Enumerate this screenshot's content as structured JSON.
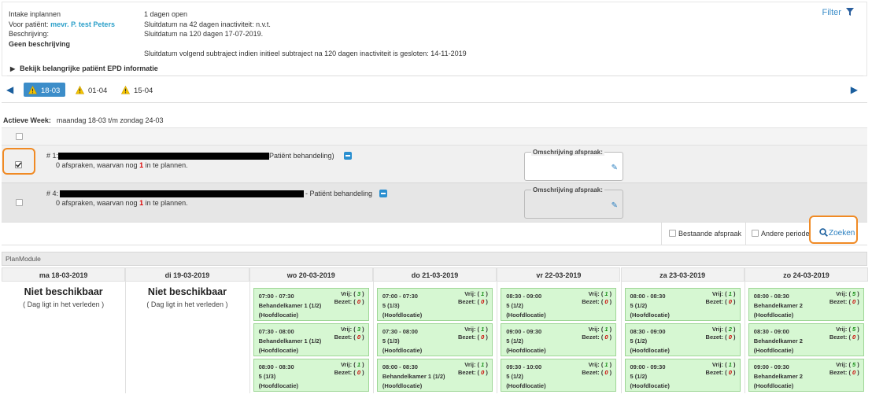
{
  "header": {
    "intake": "Intake inplannen",
    "patient_label": "Voor patiënt:",
    "patient_name": "mevr. P. test Peters",
    "beschrijving_label": "Beschrijving:",
    "beschrijving_value": "Geen beschrijving",
    "dagen_open": "1 dagen open",
    "sluit42": "Sluitdatum na 42 dagen inactiviteit: n.v.t.",
    "sluit120": "Sluitdatum na 120 dagen 17-07-2019.",
    "sluit_volgend": "Sluitdatum volgend subtraject indien initieel subtraject na 120 dagen inactiviteit is gesloten: 14-11-2019",
    "filter_label": "Filter",
    "epd_link": "Bekijk belangrijke patiënt EPD informatie"
  },
  "weeknav": {
    "tabs": [
      "18-03",
      "01-04",
      "15-04"
    ],
    "active_index": 0,
    "active_week_label": "Actieve Week:",
    "active_week_value": "maandag 18-03 t/m zondag 24-03"
  },
  "rows": [
    {
      "prefix": "# 1:",
      "suffix": "Patiënt behandeling)",
      "line2_a": "0 afspraken, waarvan nog ",
      "count": "1",
      "line2_b": " in te plannen.",
      "checked": true,
      "omschrijving_label": "Omschrijving afspraak:"
    },
    {
      "prefix": "# 4:",
      "suffix": "- Patiënt behandeling",
      "line2_a": "0 afspraken, waarvan nog ",
      "count": "1",
      "line2_b": " in te plannen.",
      "checked": false,
      "omschrijving_label": "Omschrijving afspraak:"
    }
  ],
  "searchbar": {
    "bestaande": "Bestaande afspraak",
    "andere": "Andere periode",
    "zoeken": "Zoeken"
  },
  "planmodule": {
    "title": "PlanModule",
    "niet_beschikbaar": "Niet beschikbaar",
    "verleden": "( Dag ligt in het verleden )",
    "vrij_label": "Vrij:",
    "bezet_label": "Bezet:",
    "days": [
      {
        "label": "ma 18-03-2019",
        "slots": []
      },
      {
        "label": "di 19-03-2019",
        "slots": []
      },
      {
        "label": "wo 20-03-2019",
        "slots": [
          {
            "time": "07:00 - 07:30",
            "room": "Behandelkamer 1 (1/2)",
            "loc": "(Hoofdlocatie)",
            "vrij": "3",
            "bezet": "0"
          },
          {
            "time": "07:30 - 08:00",
            "room": "Behandelkamer 1 (1/2)",
            "loc": "(Hoofdlocatie)",
            "vrij": "3",
            "bezet": "0"
          },
          {
            "time": "08:00 - 08:30",
            "room": "5 (1/3)",
            "loc": "(Hoofdlocatie)",
            "vrij": "1",
            "bezet": "0"
          }
        ]
      },
      {
        "label": "do 21-03-2019",
        "slots": [
          {
            "time": "07:00 - 07:30",
            "room": "5 (1/3)",
            "loc": "(Hoofdlocatie)",
            "vrij": "1",
            "bezet": "0"
          },
          {
            "time": "07:30 - 08:00",
            "room": "5 (1/3)",
            "loc": "(Hoofdlocatie)",
            "vrij": "1",
            "bezet": "0"
          },
          {
            "time": "08:00 - 08:30",
            "room": "Behandelkamer 1 (1/2)",
            "loc": "(Hoofdlocatie)",
            "vrij": "1",
            "bezet": "0"
          }
        ]
      },
      {
        "label": "vr 22-03-2019",
        "slots": [
          {
            "time": "08:30 - 09:00",
            "room": "5 (1/2)",
            "loc": "(Hoofdlocatie)",
            "vrij": "1",
            "bezet": "0"
          },
          {
            "time": "09:00 - 09:30",
            "room": "5 (1/2)",
            "loc": "(Hoofdlocatie)",
            "vrij": "1",
            "bezet": "0"
          },
          {
            "time": "09:30 - 10:00",
            "room": "5 (1/2)",
            "loc": "(Hoofdlocatie)",
            "vrij": "1",
            "bezet": "0"
          }
        ]
      },
      {
        "label": "za 23-03-2019",
        "slots": [
          {
            "time": "08:00 - 08:30",
            "room": "5 (1/2)",
            "loc": "(Hoofdlocatie)",
            "vrij": "1",
            "bezet": "0"
          },
          {
            "time": "08:30 - 09:00",
            "room": "5 (1/2)",
            "loc": "(Hoofdlocatie)",
            "vrij": "2",
            "bezet": "0"
          },
          {
            "time": "09:00 - 09:30",
            "room": "5 (1/2)",
            "loc": "(Hoofdlocatie)",
            "vrij": "1",
            "bezet": "0"
          }
        ]
      },
      {
        "label": "zo 24-03-2019",
        "slots": [
          {
            "time": "08:00 - 08:30",
            "room": "Behandelkamer 2",
            "loc": "(Hoofdlocatie)",
            "vrij": "5",
            "bezet": "0"
          },
          {
            "time": "08:30 - 09:00",
            "room": "Behandelkamer 2",
            "loc": "(Hoofdlocatie)",
            "vrij": "5",
            "bezet": "0"
          },
          {
            "time": "09:00 - 09:30",
            "room": "Behandelkamer 2",
            "loc": "(Hoofdlocatie)",
            "vrij": "5",
            "bezet": "0"
          }
        ]
      }
    ]
  }
}
